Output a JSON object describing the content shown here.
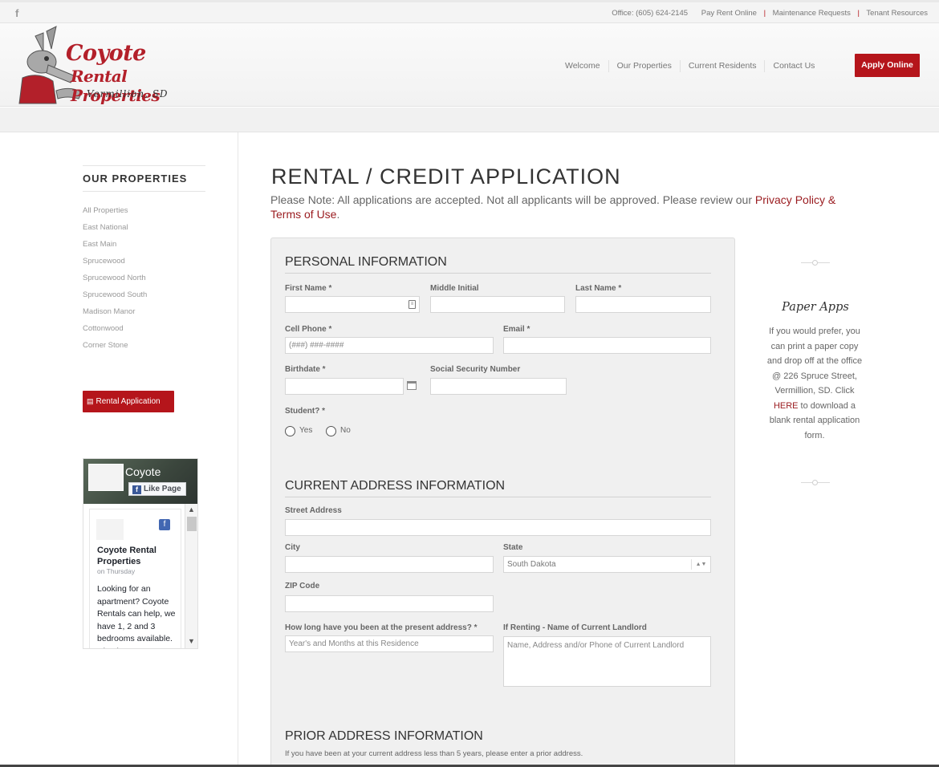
{
  "topbar": {
    "office": "Office: (605) 624-2145",
    "links": [
      "Pay Rent Online",
      "Maintenance Requests",
      "Tenant Resources"
    ]
  },
  "logo": {
    "line1": "Coyote",
    "line2": "Rental Properties",
    "line3": "Vermillion, SD"
  },
  "nav": {
    "items": [
      "Welcome",
      "Our Properties",
      "Current Residents",
      "Contact Us"
    ],
    "apply": "Apply Online"
  },
  "sidebar": {
    "title": "OUR PROPERTIES",
    "items": [
      "All Properties",
      "East National",
      "East Main",
      "Sprucewood",
      "Sprucewood North",
      "Sprucewood South",
      "Madison Manor",
      "Cottonwood",
      "Corner Stone"
    ],
    "rental_button": "Rental Application"
  },
  "fb_widget": {
    "page_name": "Coyote",
    "like_label": "Like Page",
    "post_name": "Coyote Rental Properties",
    "post_when": "on Thursday",
    "post_text": "Looking for an apartment? Coyote Rentals can help, we have 1, 2 and 3 bedrooms available. Check us"
  },
  "main": {
    "title": "RENTAL / CREDIT APPLICATION",
    "note_text": "Please Note: All applications are accepted. Not all applicants will be approved. Please review our ",
    "note_link": "Privacy Policy & Terms of Use",
    "note_end": "."
  },
  "form": {
    "personal": {
      "title": "PERSONAL INFORMATION",
      "first_name": "First Name *",
      "middle_initial": "Middle Initial",
      "last_name": "Last Name *",
      "cell_phone": "Cell Phone *",
      "cell_phone_placeholder": "(###) ###-####",
      "email": "Email *",
      "birthdate": "Birthdate *",
      "ssn": "Social Security Number",
      "student": "Student? *",
      "yes": "Yes",
      "no": "No"
    },
    "current": {
      "title": "CURRENT ADDRESS INFORMATION",
      "street": "Street Address",
      "city": "City",
      "state": "State",
      "state_value": "South Dakota",
      "zip": "ZIP Code",
      "how_long": "How long have you been at the present address? *",
      "how_long_placeholder": "Year's and Months at this Residence",
      "landlord": "If Renting - Name of Current Landlord",
      "landlord_placeholder": "Name, Address and/or Phone of Current Landlord"
    },
    "prior": {
      "title": "PRIOR ADDRESS INFORMATION",
      "note": "If you have been at your current address less than 5 years, please enter a prior address."
    }
  },
  "paper_apps": {
    "title": "Paper Apps",
    "text_before": "If you would prefer, you can print a paper copy and drop off at the office @ 226 Spruce Street, Vermillion, SD.  Click ",
    "link": "HERE",
    "text_after": " to download a blank rental application form."
  },
  "colors": {
    "accent": "#b5151b",
    "link": "#9a1b1f",
    "form_bg": "#f0f0f0"
  }
}
